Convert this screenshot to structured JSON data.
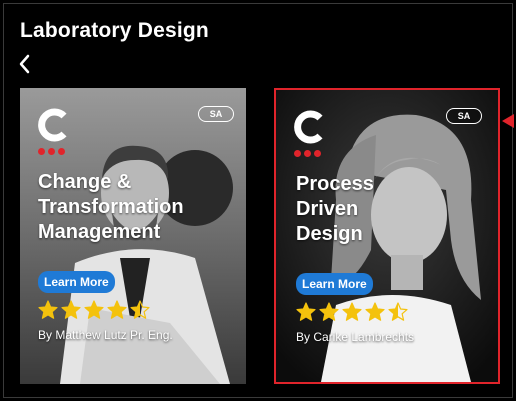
{
  "page": {
    "title": "Laboratory Design"
  },
  "colors": {
    "accent": "#e0242b",
    "button": "#1f7ad6",
    "star": "#f4c20d"
  },
  "icons": {
    "back": "chevron-left-icon",
    "logo": "c-logo-icon",
    "star": "star-icon"
  },
  "cards": [
    {
      "badge": "SA",
      "title": "Change &\nTransformation\nManagement",
      "button_label": "Learn More",
      "rating": 4.5,
      "author": "By Matthew Lutz Pr. Eng."
    },
    {
      "badge": "SA",
      "title": "Process\nDriven\nDesign",
      "button_label": "Learn More",
      "rating": 4.5,
      "author": "By Carike Lambrechts"
    }
  ]
}
